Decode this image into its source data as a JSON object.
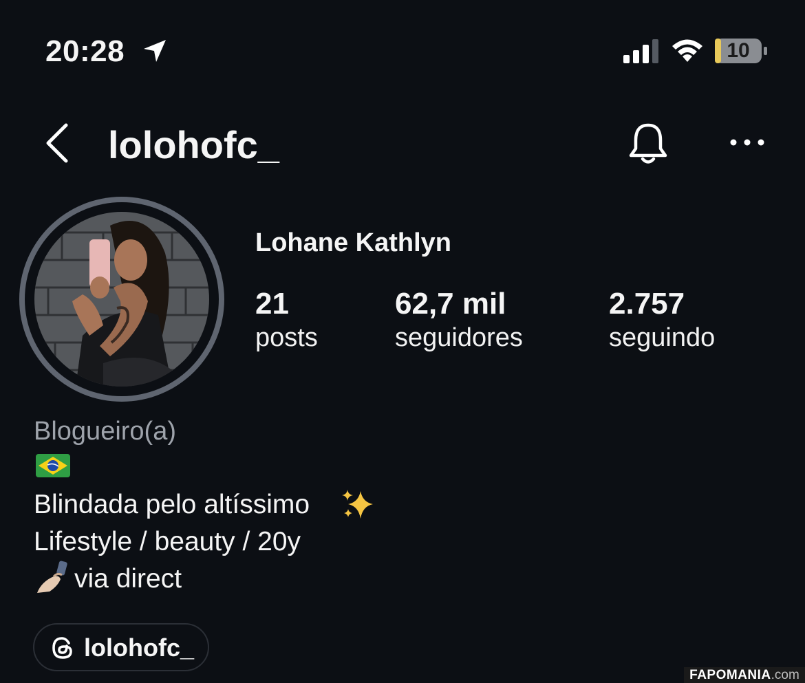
{
  "status_bar": {
    "time": "20:28",
    "battery_level": "10",
    "battery_color": "#e8c95a"
  },
  "header": {
    "username": "lolohofc_"
  },
  "profile": {
    "full_name": "Lohane Kathlyn",
    "stats": [
      {
        "value": "21",
        "label": "posts"
      },
      {
        "value": "62,7 mil",
        "label": "seguidores"
      },
      {
        "value": "2.757",
        "label": "seguindo"
      }
    ],
    "category": "Blogueiro(a)",
    "bio": {
      "line1": "Blindada pelo altíssimo",
      "line2": "Lifestyle / beauty / 20y",
      "line3": "via direct"
    },
    "threads_handle": "lolohofc_"
  },
  "watermark": {
    "brand": "FAPOMANIA",
    "suffix": ".com"
  },
  "colors": {
    "background": "#0c0f14",
    "text": "#f5f5f5",
    "muted": "#9ea3ab"
  }
}
